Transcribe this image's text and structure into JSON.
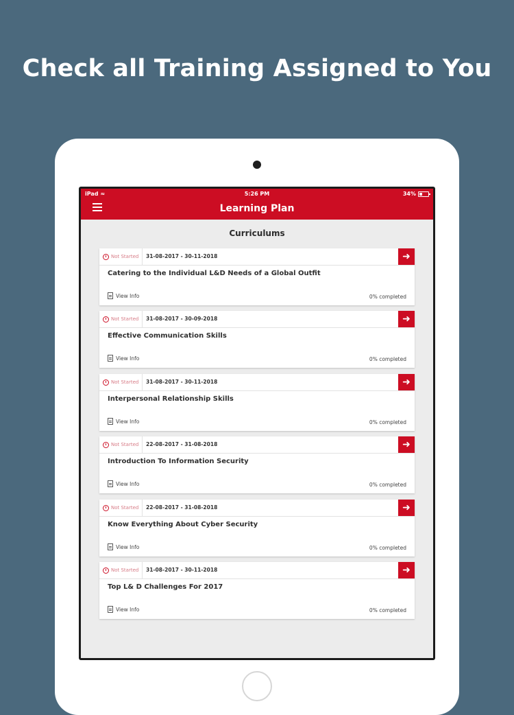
{
  "headline": "Check all Training Assigned to You",
  "status_bar": {
    "device": "iPad",
    "time": "5:26 PM",
    "battery": "34%"
  },
  "app_bar": {
    "title": "Learning Plan"
  },
  "section_title": "Curriculums",
  "view_info_label": "View Info",
  "colors": {
    "accent": "#cc0d23",
    "background": "#4b697d"
  },
  "curriculums": [
    {
      "status": "Not Started",
      "dates": "31-08-2017 - 30-11-2018",
      "title": "Catering to the Individual L&D Needs of a Global Outfit",
      "progress": "0% completed"
    },
    {
      "status": "Not Started",
      "dates": "31-08-2017 - 30-09-2018",
      "title": "Effective Communication Skills",
      "progress": "0% completed"
    },
    {
      "status": "Not Started",
      "dates": "31-08-2017 - 30-11-2018",
      "title": "Interpersonal Relationship Skills",
      "progress": "0% completed"
    },
    {
      "status": "Not Started",
      "dates": "22-08-2017 - 31-08-2018",
      "title": "Introduction To Information Security",
      "progress": "0% completed"
    },
    {
      "status": "Not Started",
      "dates": "22-08-2017 - 31-08-2018",
      "title": "Know Everything About Cyber Security",
      "progress": "0% completed"
    },
    {
      "status": "Not Started",
      "dates": "31-08-2017 - 30-11-2018",
      "title": "Top L& D Challenges For 2017",
      "progress": "0% completed"
    }
  ]
}
